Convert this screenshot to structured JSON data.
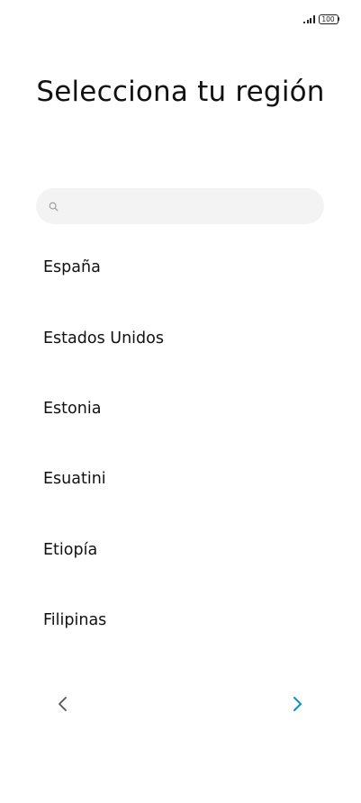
{
  "status_bar": {
    "battery_level": "100"
  },
  "title": "Selecciona tu región",
  "search": {
    "placeholder": "",
    "value": ""
  },
  "regions": [
    {
      "label": "España"
    },
    {
      "label": "Estados Unidos"
    },
    {
      "label": "Estonia"
    },
    {
      "label": "Esuatini"
    },
    {
      "label": "Etiopía"
    },
    {
      "label": "Filipinas"
    }
  ],
  "navigation": {
    "back_icon": "chevron-left-icon",
    "next_icon": "chevron-right-icon"
  },
  "colors": {
    "accent": "#0e8fc4",
    "back_arrow": "#555555",
    "search_bg": "#f3f3f3",
    "text": "#111111"
  }
}
